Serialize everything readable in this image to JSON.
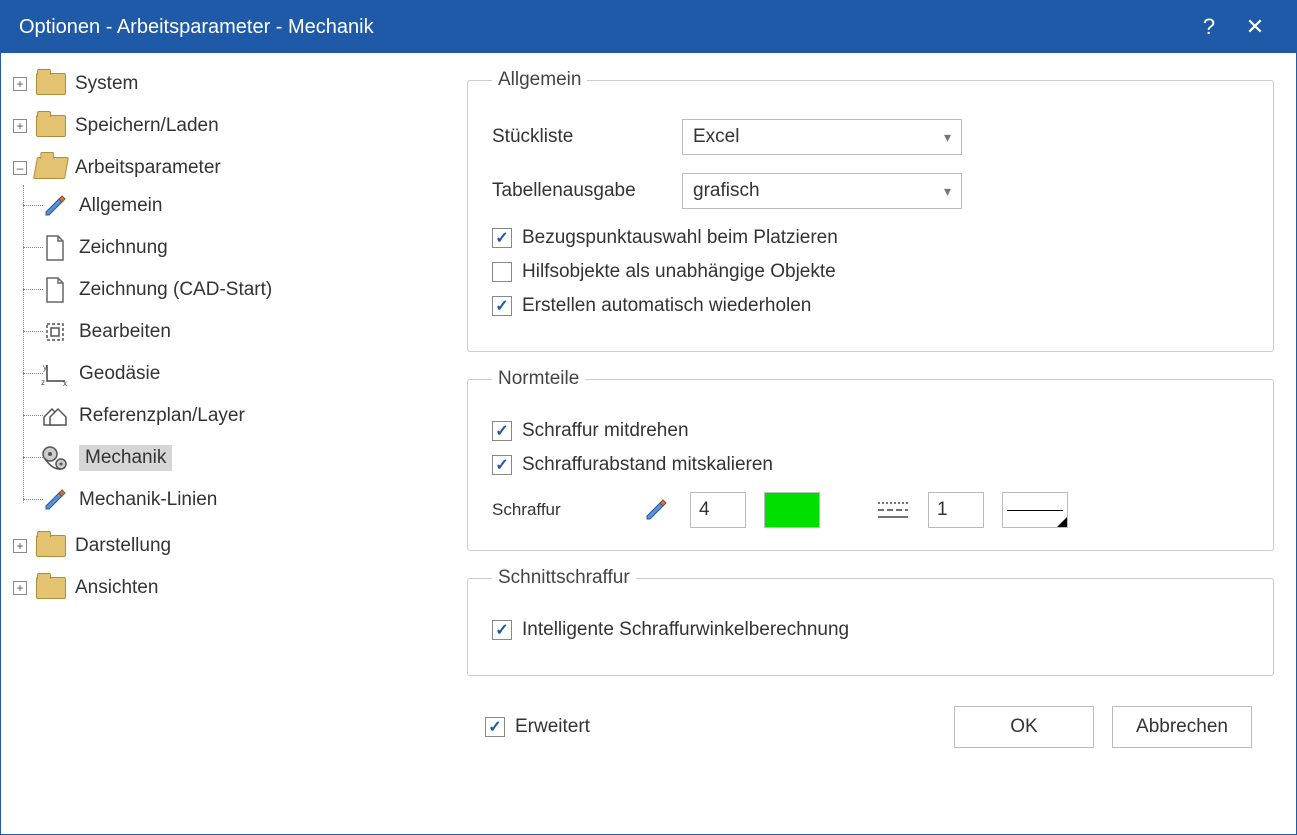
{
  "titlebar": {
    "title": "Optionen - Arbeitsparameter - Mechanik"
  },
  "tree": {
    "system": "System",
    "save": "Speichern/Laden",
    "work": "Arbeitsparameter",
    "work_children": {
      "allgemein": "Allgemein",
      "zeichnung": "Zeichnung",
      "zeichnung_cad": "Zeichnung (CAD-Start)",
      "bearbeiten": "Bearbeiten",
      "geodaesie": "Geodäsie",
      "referenzplan": "Referenzplan/Layer",
      "mechanik": "Mechanik",
      "mechanik_linien": "Mechanik-Linien"
    },
    "darstellung": "Darstellung",
    "ansichten": "Ansichten"
  },
  "groups": {
    "allgemein": {
      "legend": "Allgemein",
      "stueckliste_label": "Stückliste",
      "stueckliste_value": "Excel",
      "tabellenausgabe_label": "Tabellenausgabe",
      "tabellenausgabe_value": "grafisch",
      "chk_bezugspunkt": "Bezugspunktauswahl beim Platzieren",
      "chk_hilfsobjekte": "Hilfsobjekte als unabhängige Objekte",
      "chk_erstellen": "Erstellen automatisch wiederholen"
    },
    "normteile": {
      "legend": "Normteile",
      "chk_schraffur_mitdrehen": "Schraffur mitdrehen",
      "chk_schraffurabstand": "Schraffurabstand mitskalieren",
      "schraffur_label": "Schraffur",
      "schraffur_value": "4",
      "linetype_value": "1"
    },
    "schnitt": {
      "legend": "Schnittschraffur",
      "chk_intelligente": "Intelligente Schraffurwinkelberechnung"
    }
  },
  "footer": {
    "erweitert": "Erweitert",
    "ok": "OK",
    "abbrechen": "Abbrechen"
  }
}
